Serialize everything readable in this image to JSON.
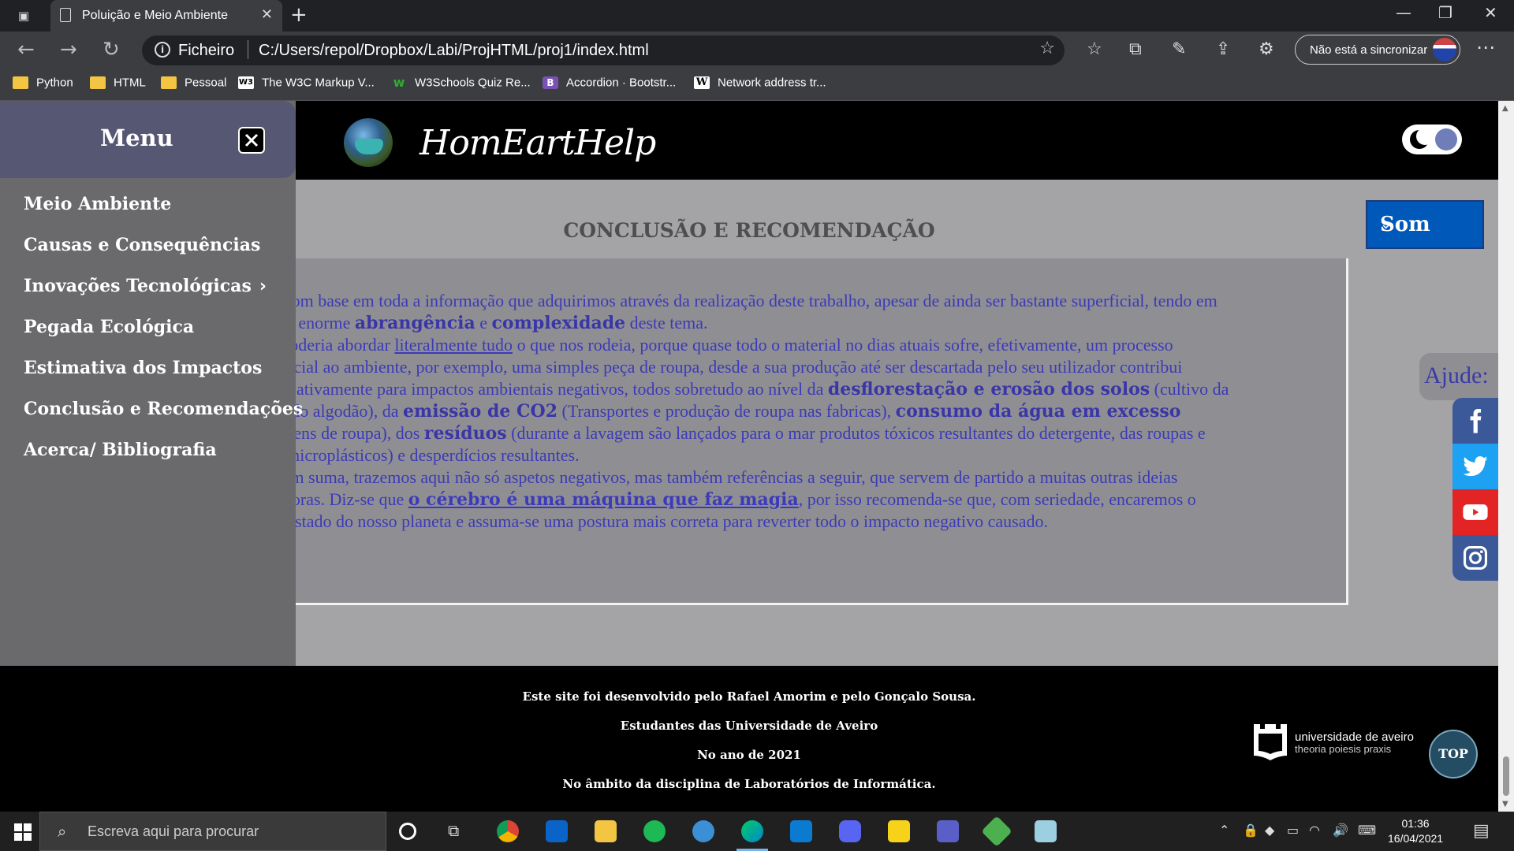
{
  "browser": {
    "tab_title": "Poluição e Meio Ambiente",
    "url_scheme": "Ficheiro",
    "url_path": "C:/Users/repol/Dropbox/Labi/ProjHTML/proj1/index.html",
    "sync_label": "Não está a sincronizar",
    "bookmarks": [
      "Python",
      "HTML",
      "Pessoal",
      "The W3C Markup V...",
      "W3Schools Quiz Re...",
      "Accordion · Bootstr...",
      "Network address tr..."
    ]
  },
  "header": {
    "brand": "HomEartHelp"
  },
  "sidebar": {
    "title": "Menu",
    "items": [
      "Meio Ambiente",
      "Causas e Consequências",
      "Inovações Tecnológicas",
      "Pegada Ecológica",
      "Estimativa dos Impactos",
      "Conclusão e Recomendações",
      "Acerca/ Bibliografia"
    ]
  },
  "main": {
    "section_title": "CONCLUSÃO E RECOMENDAÇÃO",
    "p1": {
      "a": "Com base em toda a informação que adquirimos através da realização deste trabalho, apesar de ainda ser bastante superficial, tendo em conta a enorme ",
      "b1": "abrangência",
      "c": " e ",
      "b2": "complexidade",
      "d": " deste tema."
    },
    "p2": {
      "a": "Poderia abordar ",
      "link": "literalmente tudo",
      "b": " o que nos rodeia, porque quase todo o material no dias atuais sofre, efetivamente, um processo prejudicial ao ambiente, por exemplo, uma simples peça de roupa, desde a sua produção até ser descartada pelo seu utilizador contribui significativamente para impactos ambientais negativos, todos sobretudo ao nível da ",
      "b1": "desflorestação e erosão dos solos",
      "c": " (cultivo da planta do algodão), da ",
      "b2": "emissão de CO2",
      "d": " (Transportes e produção de roupa nas fabricas), ",
      "b3": "consumo da água em excesso",
      "e": " (Lavagens de roupa), dos ",
      "b4": "resíduos",
      "f": " (durante a lavagem são lançados para o mar produtos tóxicos resultantes do detergente, das roupas e ainda microplásticos) e desperdícios resultantes."
    },
    "p3": {
      "a": "Em suma, trazemos aqui não só aspetos negativos, mas também referências a seguir, que servem de partido a muitas outras ideias inovadoras. Diz-se que ",
      "link": "o cérebro é uma máquina que faz magia",
      "b": ", por isso recomenda-se que, com seriedade, encaremos o grave estado do nosso planeta e assuma-se uma postura mais correta para reverter todo o impacto negativo causado."
    }
  },
  "sound_select": {
    "value": "Som"
  },
  "help": {
    "label": "Ajude:"
  },
  "footer": {
    "line1": "Este site foi desenvolvido pelo Rafael Amorim e pelo Gonçalo Sousa.",
    "line2": "Estudantes das Universidade de Aveiro",
    "line3": "No ano de 2021",
    "line4": "No âmbito da disciplina de Laboratórios de Informática.",
    "ua_name": "universidade de aveiro",
    "ua_motto": "theoria poiesis praxis",
    "top_label": "TOP"
  },
  "taskbar": {
    "search_placeholder": "Escreva aqui para procurar",
    "time": "01:36",
    "date": "16/04/2021"
  }
}
